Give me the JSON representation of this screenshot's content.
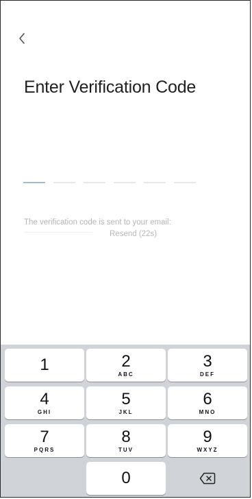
{
  "nav": {
    "back_icon": "chevron-left-icon"
  },
  "title": "Enter Verification Code",
  "code": {
    "length": 6,
    "active_index": 0
  },
  "info_text": "The verification code is sent to your email:",
  "resend_label": "Resend (22s)",
  "colors": {
    "active_underline": "#a9bcc6",
    "slot_underline": "#e6e8ea",
    "keypad_bg": "#d0d3d8"
  },
  "keypad": {
    "keys": [
      {
        "num": "1",
        "letters": ""
      },
      {
        "num": "2",
        "letters": "ABC"
      },
      {
        "num": "3",
        "letters": "DEF"
      },
      {
        "num": "4",
        "letters": "GHI"
      },
      {
        "num": "5",
        "letters": "JKL"
      },
      {
        "num": "6",
        "letters": "MNO"
      },
      {
        "num": "7",
        "letters": "PQRS"
      },
      {
        "num": "8",
        "letters": "TUV"
      },
      {
        "num": "9",
        "letters": "WXYZ"
      },
      {
        "num": "0",
        "letters": ""
      }
    ],
    "delete_icon": "backspace-icon"
  }
}
